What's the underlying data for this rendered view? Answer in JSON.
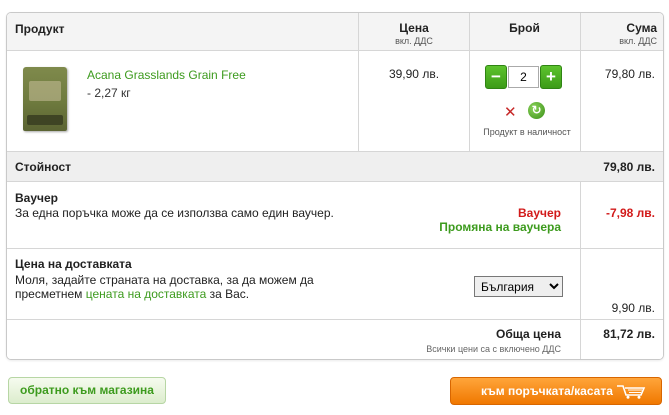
{
  "header": {
    "product": "Продукт",
    "price": "Цена",
    "price_sub": "вкл. ДДС",
    "qty": "Брой",
    "sum": "Сума",
    "sum_sub": "вкл. ДДС"
  },
  "item": {
    "name": "Acana Grasslands Grain Free",
    "weight": "- 2,27 кг",
    "price": "39,90 лв.",
    "quantity": "2",
    "in_stock": "Продукт в наличност",
    "sum": "79,80 лв.",
    "icons": [
      "minus-icon",
      "plus-icon",
      "remove-icon",
      "refresh-icon"
    ]
  },
  "subtotal": {
    "label": "Стойност",
    "value": "79,80 лв."
  },
  "voucher": {
    "label": "Ваучер",
    "description": "За една поръчка може да се използва само един ваучер.",
    "voucher_label": "Ваучер",
    "change_label": "Промяна на ваучера",
    "value": "-7,98 лв."
  },
  "shipping": {
    "label": "Цена на доставката",
    "desc_part1": "Моля, задайте страната на доставка, за да можем да пресметнем ",
    "desc_link": "цената на доставката",
    "desc_part2": " за Вас.",
    "country": "България",
    "value": "9,90 лв."
  },
  "total": {
    "label": "Обща цена",
    "note": "Всички цени са с включено ДДС",
    "value": "81,72 лв."
  },
  "buttons": {
    "back": "обратно към магазина",
    "checkout": "към поръчката/касата"
  },
  "colors": {
    "accent_green": "#3d9b1e",
    "discount_red": "#d21a1a",
    "checkout_orange": "#f07800"
  }
}
